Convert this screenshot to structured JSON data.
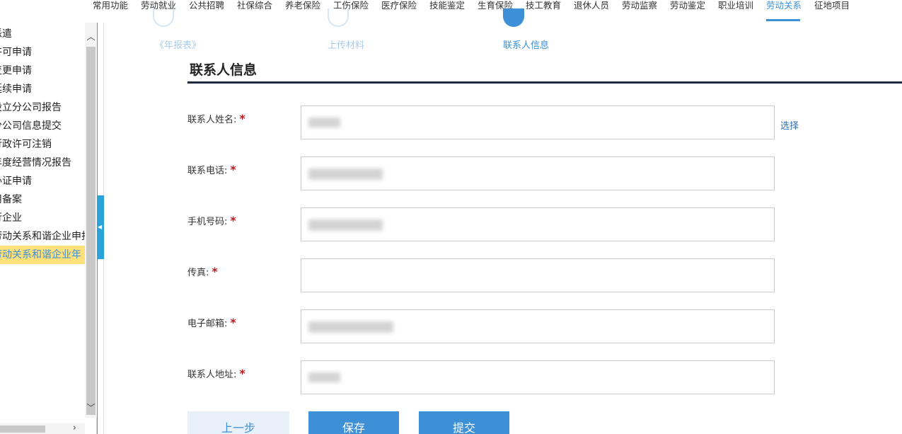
{
  "top_nav": {
    "items": [
      "常用功能",
      "劳动就业",
      "公共招聘",
      "社保综合",
      "养老保险",
      "工伤保险",
      "医疗保险",
      "技能鉴定",
      "生育保险",
      "技工教育",
      "退休人员",
      "劳动监察",
      "劳动鉴定",
      "职业培训",
      "劳动关系",
      "征地项目"
    ],
    "active": "劳动关系"
  },
  "sidebar": {
    "items": [
      "派遣",
      "许可申请",
      "变更申请",
      "延续申请",
      "设立分公司报告",
      "分公司信息提交",
      "行政许可注销",
      "年度经营情况报告",
      "办证申请",
      "用备案",
      "行企业",
      "劳动关系和谐企业申报",
      "劳动关系和谐企业年"
    ],
    "active_index": 12
  },
  "steps": {
    "items": [
      "《年报表》",
      "上传材料",
      "联系人信息"
    ],
    "current_index": 2
  },
  "form": {
    "title": "联系人信息",
    "required_mark": "*",
    "select_link": "选择",
    "fields": [
      {
        "label": "联系人姓名:"
      },
      {
        "label": "联系电话:"
      },
      {
        "label": "手机号码:"
      },
      {
        "label": "传真:"
      },
      {
        "label": "电子邮箱:"
      },
      {
        "label": "联系人地址:"
      }
    ]
  },
  "buttons": {
    "prev": "上一步",
    "save": "保存",
    "submit": "提交"
  },
  "colors": {
    "accent": "#3d8fd6",
    "active_highlight": "#ffe07a",
    "required": "#c0191f"
  }
}
